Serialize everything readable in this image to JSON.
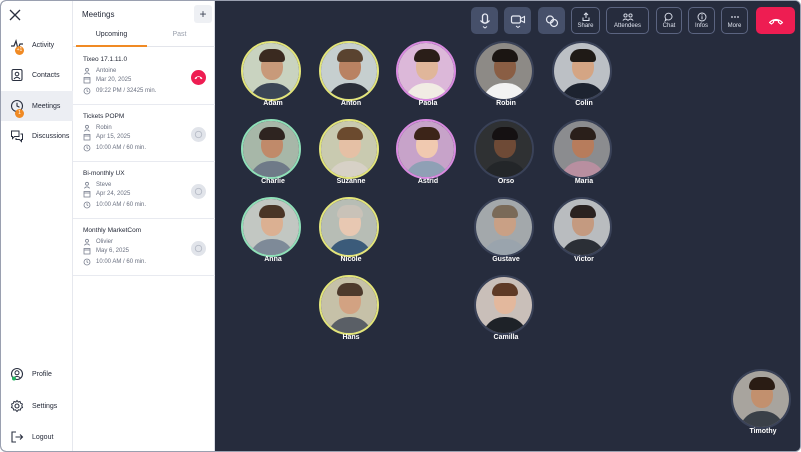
{
  "sidenav": {
    "items": [
      {
        "label": "Activity",
        "icon": "activity-icon",
        "badge": "+1"
      },
      {
        "label": "Contacts",
        "icon": "contacts-icon"
      },
      {
        "label": "Meetings",
        "icon": "clock-icon",
        "badge": "1"
      },
      {
        "label": "Discussions",
        "icon": "discussions-icon"
      }
    ],
    "bottom": [
      {
        "label": "Profile",
        "icon": "profile-icon"
      },
      {
        "label": "Settings",
        "icon": "gear-icon"
      },
      {
        "label": "Logout",
        "icon": "logout-icon"
      }
    ]
  },
  "meetings_panel": {
    "title": "Meetings",
    "add_label": "+",
    "tabs": [
      "Upcoming",
      "Past"
    ],
    "list": [
      {
        "title": "Tixeo 17.1.11.0",
        "organizer": "Antoine",
        "date": "Mar 20, 2025",
        "time": "09:22 PM / 32425 min.",
        "status": "live"
      },
      {
        "title": "Tickets POPM",
        "organizer": "Robin",
        "date": "Apr 15, 2025",
        "time": "10:00 AM / 60 min.",
        "status": "idle"
      },
      {
        "title": "Bi-monthly UX",
        "organizer": "Steve",
        "date": "Apr 24, 2025",
        "time": "10:00 AM / 60 min.",
        "status": "idle"
      },
      {
        "title": "Monthly MarketCom",
        "organizer": "Olivier",
        "date": "May 6, 2025",
        "time": "10:00 AM / 60 min.",
        "status": "idle"
      }
    ]
  },
  "toolbar": {
    "mic_icon": "microphone-icon",
    "camera_icon": "camera-icon",
    "effects_icon": "effects-icon",
    "share": "Share",
    "attendees": "Attendees",
    "chat": "Chat",
    "infos": "Infos",
    "more": "More",
    "hangup_color": "#ee1d52"
  },
  "participants": [
    {
      "name": "Adam",
      "ring": "#e3e57a"
    },
    {
      "name": "Anton",
      "ring": "#e3e57a"
    },
    {
      "name": "Paola",
      "ring": "#d98ae0"
    },
    {
      "name": "Robin",
      "ring": "#3a4258"
    },
    {
      "name": "Colin",
      "ring": "#3a4258"
    },
    {
      "name": "Charlie",
      "ring": "#8fe0b8"
    },
    {
      "name": "Suzanne",
      "ring": "#e3e57a"
    },
    {
      "name": "Astrid",
      "ring": "#d98ae0"
    },
    {
      "name": "Orso",
      "ring": "#3a4258"
    },
    {
      "name": "Maria",
      "ring": "#3a4258"
    },
    {
      "name": "Anna",
      "ring": "#8fe0b8"
    },
    {
      "name": "Nicole",
      "ring": "#e3e57a"
    },
    {
      "name": "Gustave",
      "ring": "#3a4258"
    },
    {
      "name": "Victor",
      "ring": "#3a4258"
    },
    {
      "name": "Hans",
      "ring": "#e3e57a"
    },
    {
      "name": "Camilla",
      "ring": "#3a4258"
    },
    {
      "name": "Timothy",
      "ring": "#3a4258"
    }
  ],
  "colors": {
    "stage": "#262c3d",
    "accent": "#f08a24",
    "danger": "#ee1d52"
  }
}
